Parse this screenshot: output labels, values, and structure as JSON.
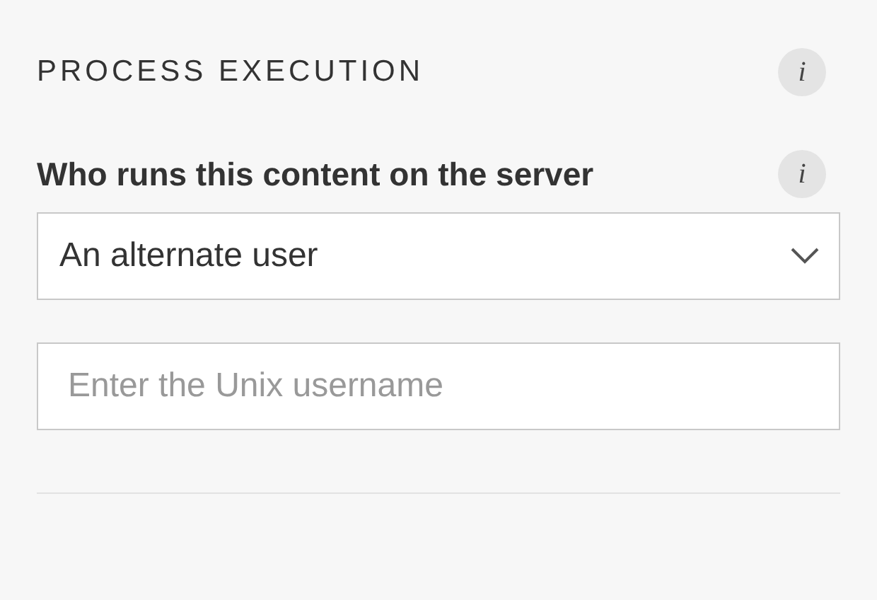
{
  "section": {
    "title": "PROCESS EXECUTION",
    "info_icon": "i"
  },
  "run_as": {
    "label": "Who runs this content on the server",
    "info_icon": "i",
    "value": "An alternate user"
  },
  "username": {
    "placeholder": "Enter the Unix username"
  }
}
